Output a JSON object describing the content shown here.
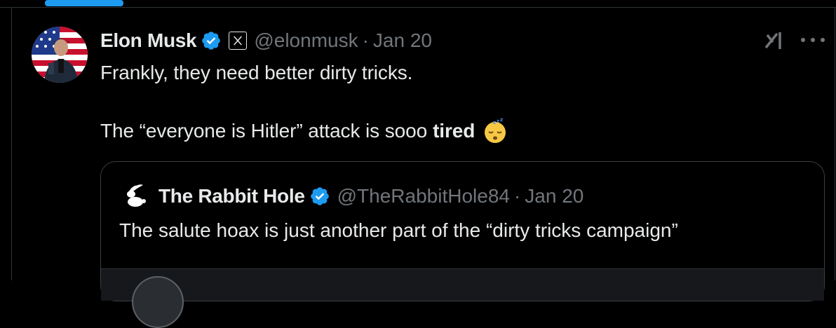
{
  "tweet": {
    "author_name": "Elon Musk",
    "handle": "@elonmusk",
    "separator": "·",
    "date": "Jan 20",
    "line1": "Frankly, they need better dirty tricks.",
    "line2_prefix": "The “everyone is Hitler” attack is sooo",
    "line2_bold": "tired",
    "emoji": "sleeping-face-emoji",
    "avatar_icon": "profile-avatar",
    "verified_icon": "verified-badge-icon",
    "affiliation_icon": "x-logo-icon",
    "grok_icon": "grok-icon",
    "more_icon": "more-options-icon"
  },
  "quote": {
    "author_name": "The Rabbit Hole",
    "handle": "@TheRabbitHole84",
    "separator": "·",
    "date": "Jan 20",
    "text": "The salute hoax is just another part of the “dirty tricks campaign”",
    "avatar_icon": "rabbit-logo-icon",
    "verified_icon": "verified-badge-icon"
  },
  "colors": {
    "background": "#000000",
    "text_primary": "#e7e9ea",
    "text_secondary": "#71767b",
    "accent": "#1d9bf0",
    "border": "#2f3336"
  }
}
